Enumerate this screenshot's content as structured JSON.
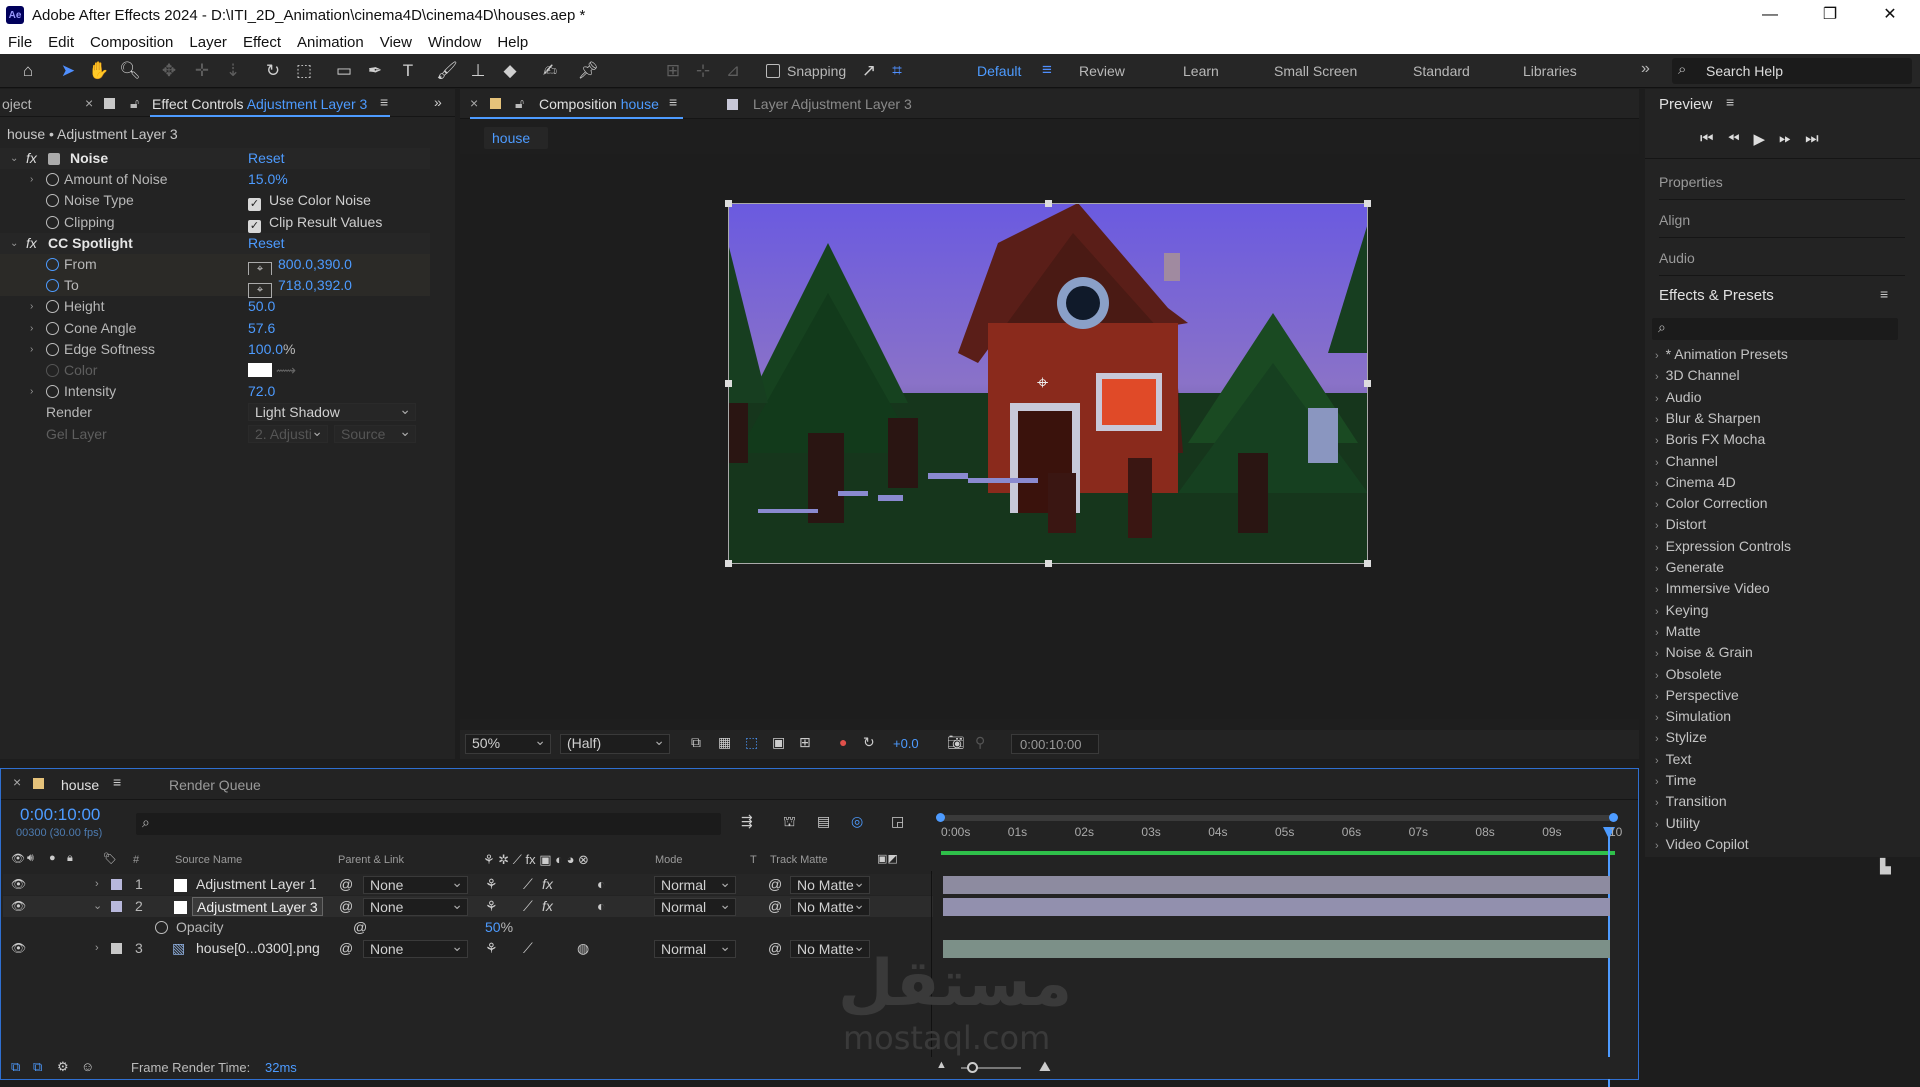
{
  "window": {
    "title": "Adobe After Effects 2024 - D:\\ITI_2D_Animation\\cinema4D\\cinema4D\\houses.aep *",
    "app_icon": "Ae",
    "controls": [
      "—",
      "❐",
      "✕"
    ]
  },
  "menu": [
    "File",
    "Edit",
    "Composition",
    "Layer",
    "Effect",
    "Animation",
    "View",
    "Window",
    "Help"
  ],
  "toolbar": {
    "snapping_label": "Snapping",
    "workspaces": [
      "Default",
      "Review",
      "Learn",
      "Small Screen",
      "Standard",
      "Libraries"
    ],
    "active_workspace": "Default",
    "more": "»",
    "search_placeholder": "Search Help"
  },
  "project_tab": {
    "label": "oject"
  },
  "effect_controls": {
    "tab_prefix": "Effect Controls",
    "tab_layer": "Adjustment Layer 3",
    "breadcrumb": "house • Adjustment Layer 3",
    "fx_icon": "fx",
    "effects": [
      {
        "name": "Noise",
        "reset": "Reset",
        "props": [
          {
            "name": "Amount of Noise",
            "value": "15.0%"
          },
          {
            "name": "Noise Type",
            "check": "Use Color Noise"
          },
          {
            "name": "Clipping",
            "check": "Clip Result Values"
          }
        ]
      },
      {
        "name": "CC Spotlight",
        "reset": "Reset",
        "props": [
          {
            "name": "From",
            "value": "800.0,390.0"
          },
          {
            "name": "To",
            "value": "718.0,392.0"
          },
          {
            "name": "Height",
            "value": "50.0"
          },
          {
            "name": "Cone Angle",
            "value": "57.6"
          },
          {
            "name": "Edge Softness",
            "value": "100.0",
            "unit": "%"
          },
          {
            "name": "Color",
            "value": ""
          },
          {
            "name": "Intensity",
            "value": "72.0"
          },
          {
            "name": "Render",
            "value": "Light Shadow"
          },
          {
            "name": "Gel Layer",
            "value": "2. Adjusti",
            "value2": "Source"
          }
        ]
      }
    ]
  },
  "composition": {
    "tab_prefix": "Composition",
    "tab_name": "house",
    "layer_tab": "Layer  Adjustment Layer 3",
    "breadcrumb_tab": "house",
    "zoom": "50%",
    "resolution": "(Half)",
    "exposure": "+0.0",
    "timecode": "0:00:10:00"
  },
  "right_panel": {
    "preview": "Preview",
    "properties": "Properties",
    "align": "Align",
    "audio": "Audio",
    "effects_presets": "Effects & Presets",
    "categories": [
      "* Animation Presets",
      "3D Channel",
      "Audio",
      "Blur & Sharpen",
      "Boris FX Mocha",
      "Channel",
      "Cinema 4D",
      "Color Correction",
      "Distort",
      "Expression Controls",
      "Generate",
      "Immersive Video",
      "Keying",
      "Matte",
      "Noise & Grain",
      "Obsolete",
      "Perspective",
      "Simulation",
      "Stylize",
      "Text",
      "Time",
      "Transition",
      "Utility",
      "Video Copilot"
    ]
  },
  "timeline": {
    "tab_name": "house",
    "render_queue": "Render Queue",
    "timecode": "0:00:10:00",
    "frame_info": "00300 (30.00 fps)",
    "columns": {
      "hash": "#",
      "source": "Source Name",
      "parent": "Parent & Link",
      "mode": "Mode",
      "t": "T",
      "matte": "Track Matte"
    },
    "ruler": [
      "0:00s",
      "01s",
      "02s",
      "03s",
      "04s",
      "05s",
      "06s",
      "07s",
      "08s",
      "09s",
      "10"
    ],
    "layers": [
      {
        "num": "1",
        "name": "Adjustment Layer 1",
        "parent": "None",
        "mode": "Normal",
        "matte": "No Matte"
      },
      {
        "num": "2",
        "name": "Adjustment Layer 3",
        "parent": "None",
        "mode": "Normal",
        "matte": "No Matte"
      },
      {
        "num": "3",
        "name": "house[0...0300].png",
        "parent": "None",
        "mode": "Normal",
        "matte": "No Matte"
      }
    ],
    "opacity_label": "Opacity",
    "opacity_value": "50",
    "opacity_unit": "%",
    "frame_render_label": "Frame Render Time:",
    "frame_render_value": "32ms"
  },
  "watermark": {
    "arabic": "مستقل",
    "latin": "mostaql.com"
  },
  "colors": {
    "accent": "#4d9bff",
    "layer_bar": "#8d8ba0",
    "work_area": "#2fbf4a"
  }
}
